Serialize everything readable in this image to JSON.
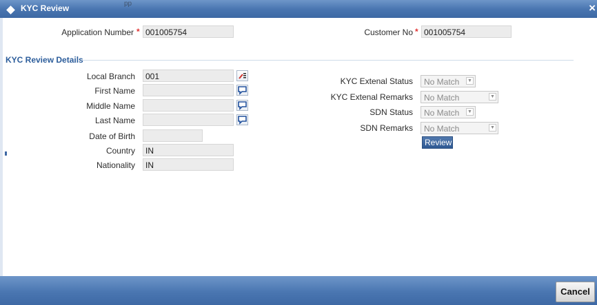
{
  "window": {
    "title": "KYC Review",
    "ghost_text": "pp"
  },
  "header": {
    "application_number": {
      "label": "Application Number",
      "required_mark": "*",
      "value": "001005754"
    },
    "customer_no": {
      "label": "Customer No",
      "required_mark": "*",
      "value": "001005754"
    }
  },
  "section": {
    "title": "KYC Review Details"
  },
  "left_fields": {
    "local_branch": {
      "label": "Local Branch",
      "value": "001"
    },
    "first_name": {
      "label": "First Name",
      "value": ""
    },
    "middle_name": {
      "label": "Middle Name",
      "value": ""
    },
    "last_name": {
      "label": "Last Name",
      "value": ""
    },
    "date_of_birth": {
      "label": "Date of Birth",
      "value": ""
    },
    "country": {
      "label": "Country",
      "value": "IN"
    },
    "nationality": {
      "label": "Nationality",
      "value": "IN"
    }
  },
  "right_fields": {
    "kyc_external_status": {
      "label": "KYC Extenal Status",
      "value": "No Match"
    },
    "kyc_external_remarks": {
      "label": "KYC Extenal Remarks",
      "value": "No Match"
    },
    "sdn_status": {
      "label": "SDN Status",
      "value": "No Match"
    },
    "sdn_remarks": {
      "label": "SDN Remarks",
      "value": "No Match"
    }
  },
  "buttons": {
    "review": "Review",
    "cancel": "Cancel",
    "close": "×"
  },
  "icons": {
    "title": "diamond-icon",
    "branch_lookup": "list-lookup-icon",
    "name_lookup": "speech-bubble-icon",
    "dropdown": "chevron-down-icon"
  },
  "colors": {
    "title_bar": "#4a76b1",
    "section_title": "#2c5d9b",
    "required": "#e03333",
    "review_button": "#3a639c"
  }
}
